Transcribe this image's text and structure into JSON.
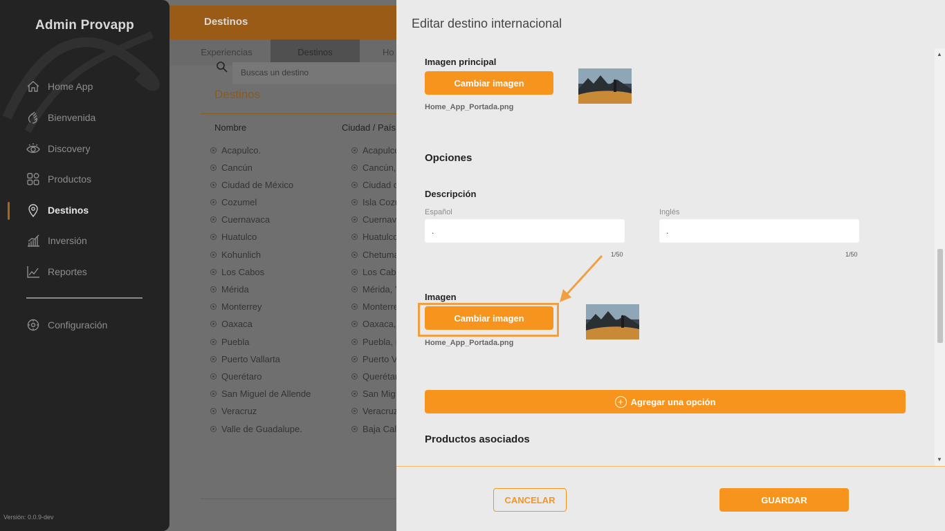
{
  "sidebar": {
    "brand": "Admin Provapp",
    "version": "Versión: 0.0.9-dev",
    "items": [
      {
        "label": "Home App",
        "icon": "home-icon"
      },
      {
        "label": "Bienvenida",
        "icon": "hand-wave-icon"
      },
      {
        "label": "Discovery",
        "icon": "eye-icon"
      },
      {
        "label": "Productos",
        "icon": "grid-icon"
      },
      {
        "label": "Destinos",
        "icon": "location-pin-icon",
        "active": true
      },
      {
        "label": "Inversión",
        "icon": "bar-chart-icon"
      },
      {
        "label": "Reportes",
        "icon": "line-chart-icon"
      }
    ],
    "settings": {
      "label": "Configuración",
      "icon": "gear-icon"
    }
  },
  "main": {
    "header_title": "Destinos",
    "tabs": [
      "Experiencias",
      "Destinos",
      "Ho"
    ],
    "search_placeholder": "Buscas un destino",
    "section_title": "Destinos",
    "columns": [
      "Nombre",
      "Ciudad / País"
    ],
    "rows": [
      [
        "Acapulco.",
        "Acapulco"
      ],
      [
        "Cancún",
        "Cancún,"
      ],
      [
        "Ciudad de México",
        "Ciudad c"
      ],
      [
        "Cozumel",
        "Isla Cozu"
      ],
      [
        "Cuernavaca",
        "Cuernav"
      ],
      [
        "Huatulco",
        "Huatulco"
      ],
      [
        "Kohunlich",
        "Chetuma"
      ],
      [
        "Los Cabos",
        "Los Cab"
      ],
      [
        "Mérida",
        "Mérida, Y"
      ],
      [
        "Monterrey",
        "Monterre"
      ],
      [
        "Oaxaca",
        "Oaxaca,"
      ],
      [
        "Puebla",
        "Puebla, P"
      ],
      [
        "Puerto Vallarta",
        "Puerto V"
      ],
      [
        "Querétaro",
        "Querétar"
      ],
      [
        "San Miguel de Allende",
        "San Mig"
      ],
      [
        "Veracruz",
        "Veracruz"
      ],
      [
        "Valle de Guadalupe.",
        "Baja Cal"
      ]
    ]
  },
  "modal": {
    "title": "Editar destino internacional",
    "main_image_label": "Imagen principal",
    "change_image_label": "Cambiar imagen",
    "main_image_filename": "Home_App_Portada.png",
    "options_title": "Opciones",
    "description_label": "Descripción",
    "spanish_label": "Español",
    "english_label": "Inglés",
    "spanish_value": ".",
    "english_value": ".",
    "spanish_counter": "1/50",
    "english_counter": "1/50",
    "option_image_label": "Imagen",
    "option_change_image_label": "Cambiar imagen",
    "option_image_filename": "Home_App_Portada.png",
    "add_option_label": "Agregar una opción",
    "associated_products_title": "Productos asociados",
    "cancel_label": "CANCELAR",
    "save_label": "GUARDAR"
  },
  "colors": {
    "accent": "#f7941d",
    "sidebar_bg": "#232323",
    "modal_bg": "#eaeaea"
  }
}
